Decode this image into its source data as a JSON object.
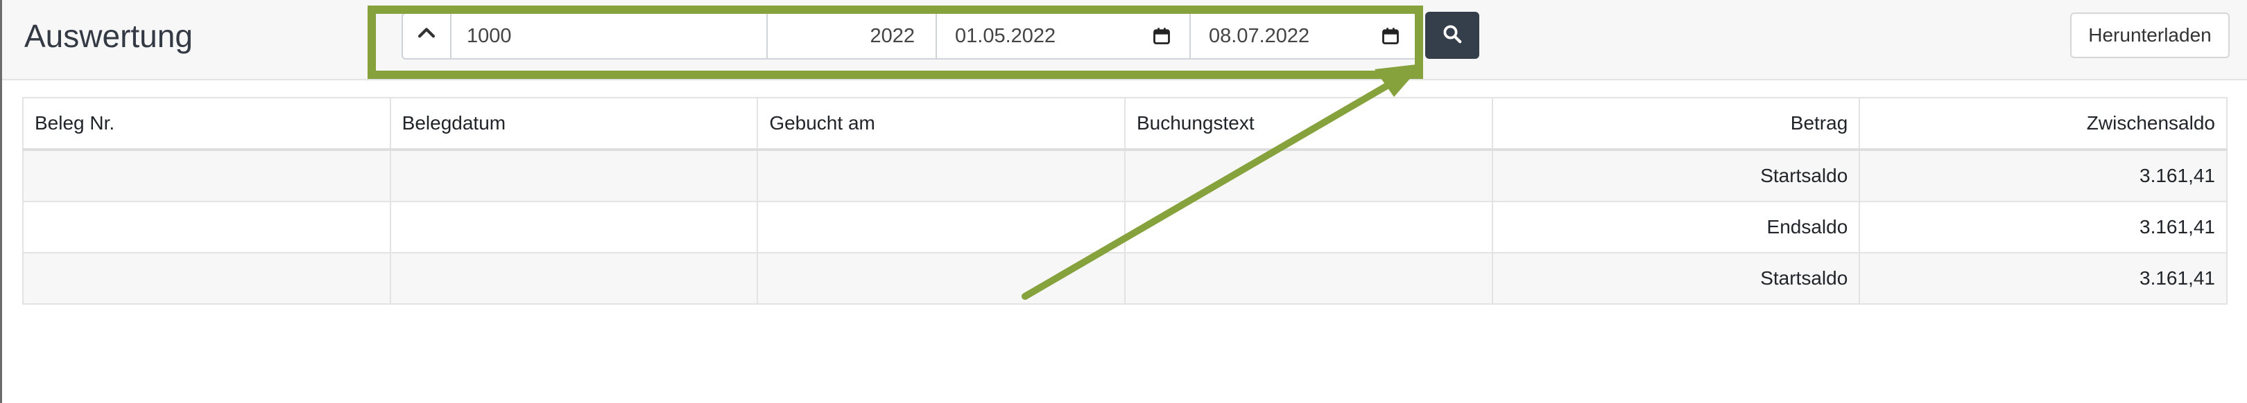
{
  "page": {
    "title": "Auswertung"
  },
  "toolbar": {
    "toggle_icon": "chevron-up-icon",
    "account_value": "1000",
    "year_value": "2022",
    "date_from": "01.05.2022",
    "date_to": "08.07.2022",
    "calendar_icon": "calendar-icon",
    "search_icon": "search-icon",
    "download_label": "Herunterladen"
  },
  "table": {
    "headers": [
      "Beleg Nr.",
      "Belegdatum",
      "Gebucht am",
      "Buchungstext",
      "Betrag",
      "Zwischensaldo"
    ],
    "rows": [
      {
        "cells": [
          "",
          "",
          "",
          "",
          "Startsaldo",
          "3.161,41"
        ]
      },
      {
        "cells": [
          "",
          "",
          "",
          "",
          "Endsaldo",
          "3.161,41"
        ]
      },
      {
        "cells": [
          "",
          "",
          "",
          "",
          "Startsaldo",
          "3.161,41"
        ]
      }
    ]
  },
  "annotation": {
    "color": "#86a23c"
  }
}
